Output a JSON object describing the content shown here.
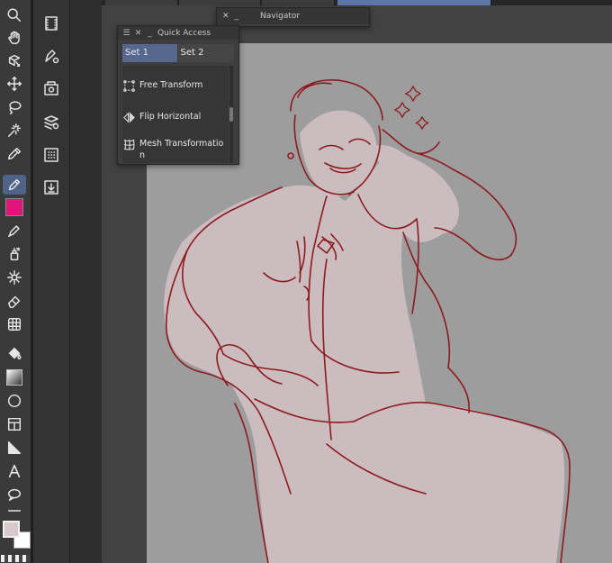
{
  "quick_access": {
    "title": "Quick Access",
    "tabs": [
      {
        "label": "Set 1",
        "active": true
      },
      {
        "label": "Set 2",
        "active": false
      }
    ],
    "items": [
      {
        "label": "Free Transform",
        "icon": "free-transform-icon"
      },
      {
        "label": "Flip Horizontal",
        "icon": "flip-horizontal-icon"
      },
      {
        "label": "Mesh Transformatio n",
        "icon": "mesh-transformation-icon"
      }
    ]
  },
  "navigator": {
    "title": "Navigator"
  },
  "colors": {
    "main_color": "#d9c9cb",
    "sub_color": "#ffffff",
    "sub_tool_color": "#e0157a",
    "canvas_bg": "#9d9d9d",
    "line_color": "#8e1a1f",
    "accent": "#5a77a6"
  },
  "toolbar": {
    "tools": [
      "zoom-icon",
      "hand-icon",
      "rotate-icon",
      "move-icon",
      "lasso-select-icon",
      "magic-wand-icon",
      "eyedropper-icon",
      "pen-icon",
      "color-swatch-icon",
      "pencil-icon",
      "airbrush-icon",
      "decoration-icon",
      "eraser-icon",
      "mesh-icon",
      "fill-icon",
      "gradient-icon",
      "ellipse-icon",
      "frame-icon",
      "ruler-icon",
      "text-icon",
      "balloon-icon",
      "line-icon"
    ]
  }
}
